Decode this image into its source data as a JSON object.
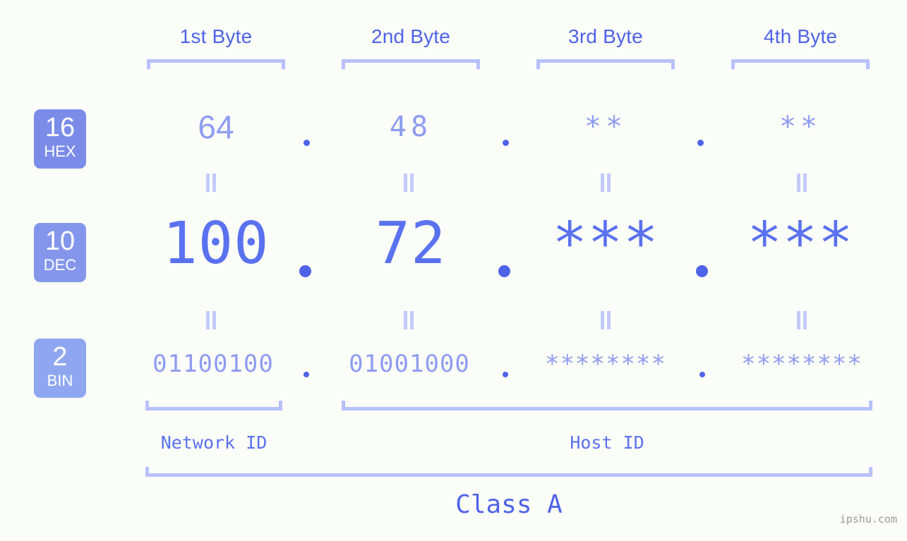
{
  "meta": {
    "background_color": "#fbfdf8",
    "accent_strong": "#4f63e8",
    "accent_mid": "#5a72ef",
    "accent_light": "#8e9cf0",
    "accent_pale": "#b7c1fb",
    "watermark": "ipshu.com"
  },
  "byte_headers": [
    {
      "label": "1st Byte"
    },
    {
      "label": "2nd Byte"
    },
    {
      "label": "3rd Byte"
    },
    {
      "label": "4th Byte"
    }
  ],
  "bases": [
    {
      "num": "16",
      "abbr": "HEX",
      "color": "#7b8ce8"
    },
    {
      "num": "10",
      "abbr": "DEC",
      "color": "#8496ec"
    },
    {
      "num": "2",
      "abbr": "BIN",
      "color": "#8fa7f0"
    }
  ],
  "rows": {
    "hex": {
      "values": [
        "64",
        "48",
        "**",
        "**"
      ],
      "separator": "."
    },
    "dec": {
      "values": [
        "100",
        "72",
        "***",
        "***"
      ],
      "separator": "."
    },
    "bin": {
      "values": [
        "01100100",
        "01001000",
        "********",
        "********"
      ],
      "separator": "."
    }
  },
  "equals_symbol": "=",
  "segments": [
    {
      "label": "Network ID"
    },
    {
      "label": "Host ID"
    }
  ],
  "class": {
    "label": "Class A"
  }
}
